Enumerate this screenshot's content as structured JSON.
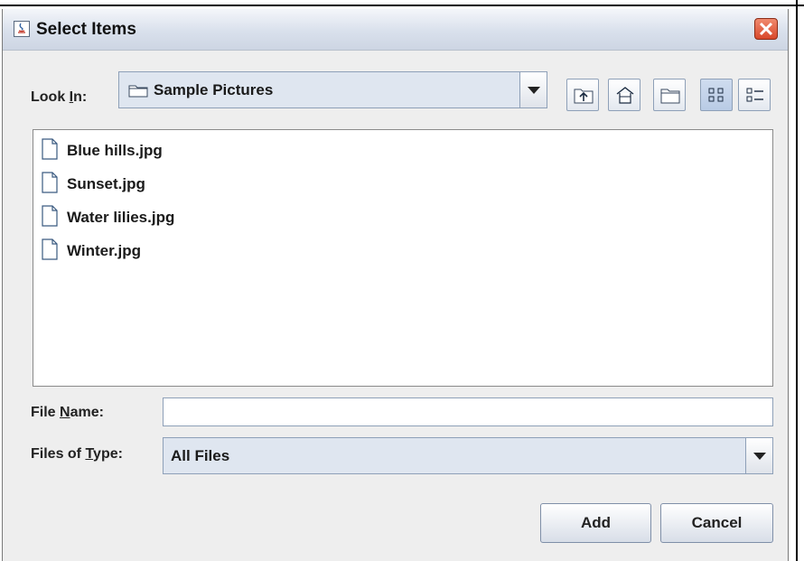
{
  "window": {
    "title": "Select Items"
  },
  "look_in": {
    "label_pre": "Look ",
    "label_mn": "I",
    "label_post": "n:",
    "value": "Sample Pictures"
  },
  "toolbar": {
    "icons": [
      "up-one-level-icon",
      "home-icon",
      "new-folder-icon",
      "list-view-icon",
      "details-view-icon"
    ]
  },
  "files": [
    {
      "name": "Blue hills.jpg"
    },
    {
      "name": "Sunset.jpg"
    },
    {
      "name": "Water lilies.jpg"
    },
    {
      "name": "Winter.jpg"
    }
  ],
  "file_name": {
    "label_pre": "File ",
    "label_mn": "N",
    "label_post": "ame:",
    "value": ""
  },
  "file_type": {
    "label_pre": "Files of ",
    "label_mn": "T",
    "label_post": "ype:",
    "value": "All Files"
  },
  "buttons": {
    "add": "Add",
    "cancel": "Cancel"
  },
  "colors": {
    "titlebar": "#d9e0ec",
    "window_bg": "#eeeeee",
    "close": "#d8472a"
  }
}
